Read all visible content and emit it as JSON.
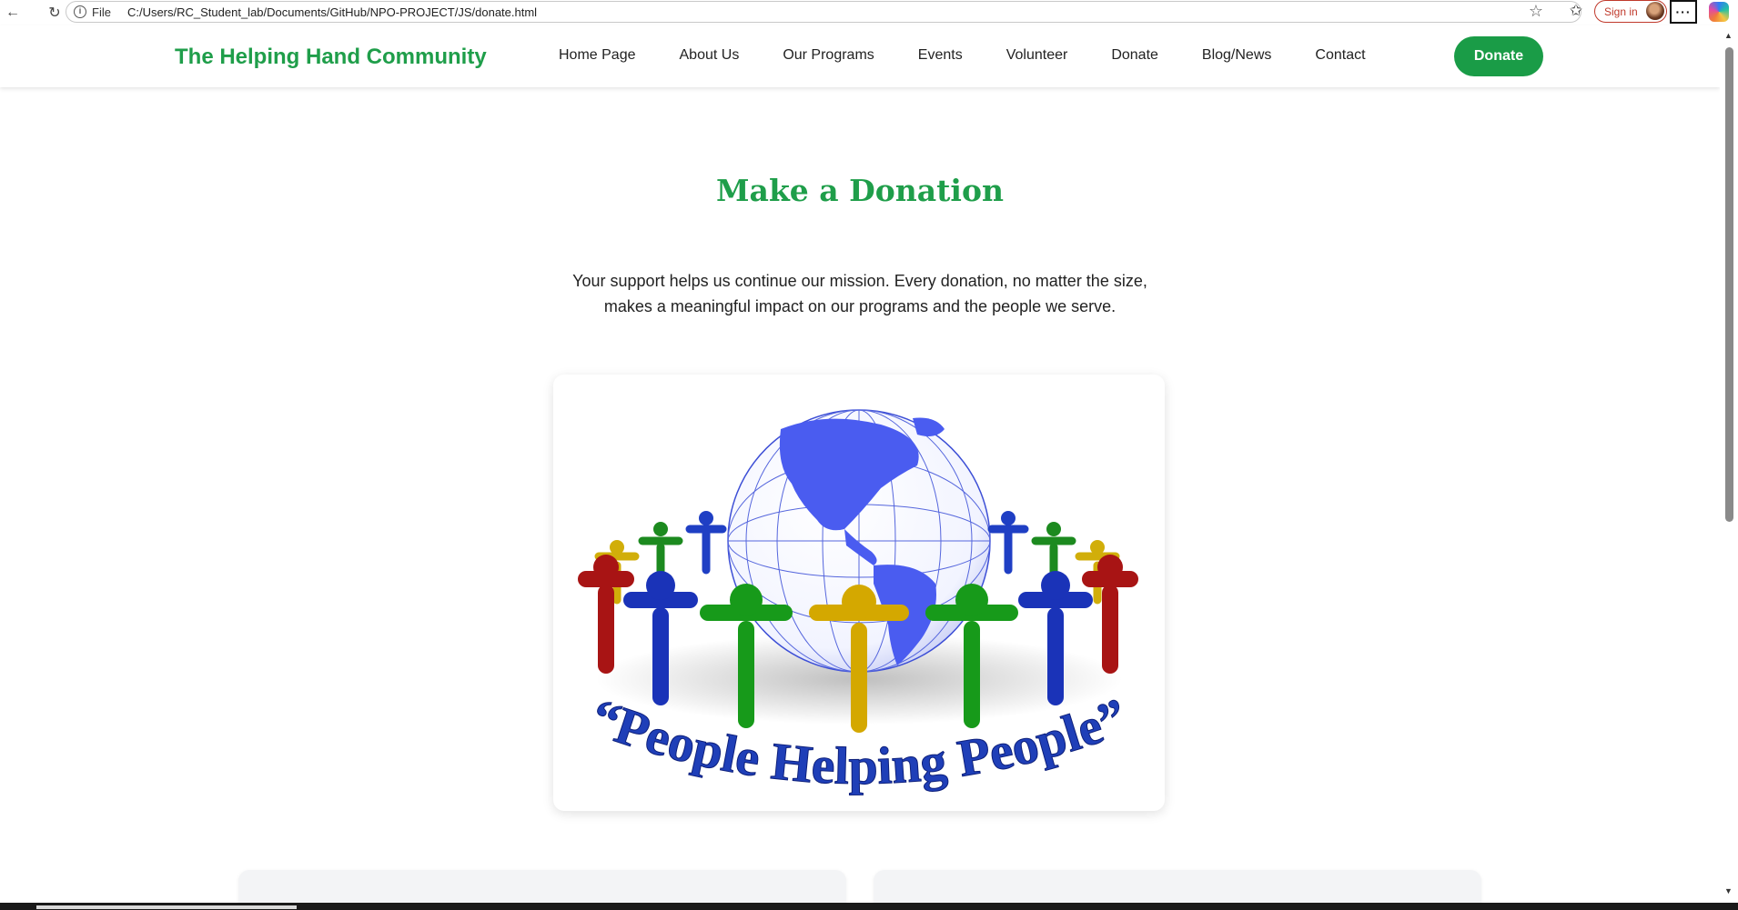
{
  "browser": {
    "file_label": "File",
    "url": "C:/Users/RC_Student_lab/Documents/GitHub/NPO-PROJECT/JS/donate.html",
    "signin_label": "Sign in",
    "more_label": "···"
  },
  "header": {
    "logo": "The Helping Hand Community",
    "nav": [
      "Home Page",
      "About Us",
      "Our Programs",
      "Events",
      "Volunteer",
      "Donate",
      "Blog/News",
      "Contact"
    ],
    "cta_label": "Donate"
  },
  "main": {
    "title": "Make a Donation",
    "intro": "Your support helps us continue our mission. Every donation, no matter the size, makes a meaningful impact on our programs and the people we serve.",
    "image_caption": "“People Helping People”"
  },
  "colors": {
    "brand_green": "#1f9e4a",
    "button_green": "#1a9c47"
  }
}
